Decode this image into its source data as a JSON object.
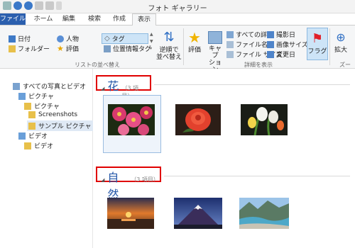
{
  "window": {
    "title": "フォト ギャラリー"
  },
  "tabs": [
    "ファイル",
    "ホーム",
    "編集",
    "検索",
    "作成",
    "表示"
  ],
  "ribbon": {
    "sort_group": {
      "date": "日付",
      "folder": "フォルダー",
      "people": "人物",
      "rating": "評価",
      "tag": "タグ",
      "location_tag": "位置情報タグ",
      "reverse_line1": "逆順で",
      "reverse_line2": "並べ替え",
      "label": "リストの並べ替え"
    },
    "details_group": {
      "rating": "評価",
      "caption_line1": "キャプ",
      "caption_line2": "ション",
      "all_details": "すべての詳細",
      "file_name": "ファイル名",
      "file_size": "ファイル サイズ",
      "date_taken": "撮影日",
      "image_size": "画像サイズ",
      "date_modified": "変更日",
      "flag": "フラグ",
      "label": "詳細を表示"
    },
    "zoom_group": {
      "zoom_in": "拡大",
      "label": "ズーム"
    }
  },
  "nav": {
    "root": "すべての写真とビデオ",
    "pictures": "ピクチャ",
    "pictures_sub": "ピクチャ",
    "screenshots": "Screenshots",
    "sample_pictures": "サンプル ピクチャ",
    "videos": "ビデオ",
    "videos_sub": "ビデオ"
  },
  "groups": [
    {
      "name": "花",
      "count": "（3 項目）",
      "photos": [
        "flowers-pink",
        "rose-red",
        "lilies-white"
      ]
    },
    {
      "name": "自然",
      "count": "（3 項目）",
      "photos": [
        "sunset-lake",
        "mountain-fuji",
        "river-valley"
      ]
    }
  ],
  "colors": {
    "accent_tab": "#2b5fae",
    "highlight_border": "#e00000",
    "group_title": "#2457a8"
  }
}
